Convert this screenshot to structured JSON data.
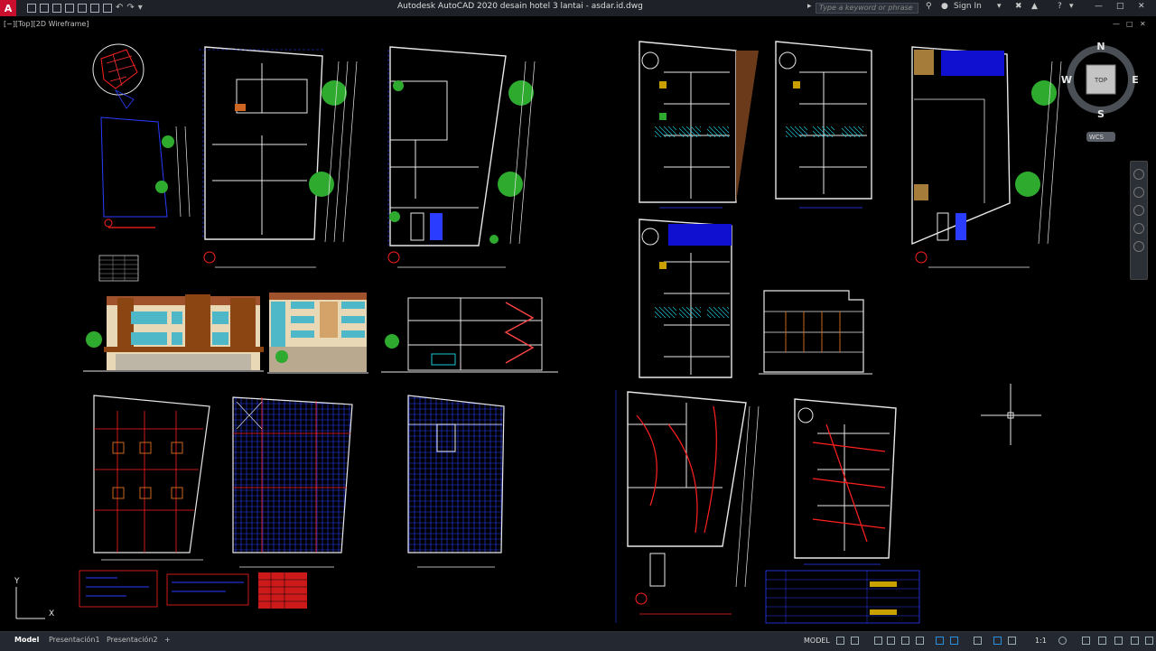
{
  "titlebar": {
    "app_letter": "A",
    "title": "Autodesk AutoCAD 2020   desain hotel 3 lantai - asdar.id.dwg",
    "search_placeholder": "Type a keyword or phrase",
    "sign_in": "Sign In",
    "help": "?"
  },
  "viewport": {
    "label": "[−][Top][2D Wireframe]"
  },
  "viewcube": {
    "north": "N",
    "south": "S",
    "east": "E",
    "west": "W",
    "top": "TOP",
    "wcs": "WCS"
  },
  "ucs": {
    "x": "X",
    "y": "Y"
  },
  "layout_tabs": [
    "Model",
    "Presentación1",
    "Presentación2",
    "+"
  ],
  "statusbar": {
    "model": "MODEL",
    "scale": "1:1"
  },
  "colors": {
    "canvas": "#000000",
    "titlebar": "#1e2228",
    "cad_white": "#e8e8e8",
    "cad_blue": "#2a3cff",
    "cad_red": "#ff2020",
    "cad_green": "#2eaa2e",
    "cad_cyan": "#18c8d8"
  }
}
